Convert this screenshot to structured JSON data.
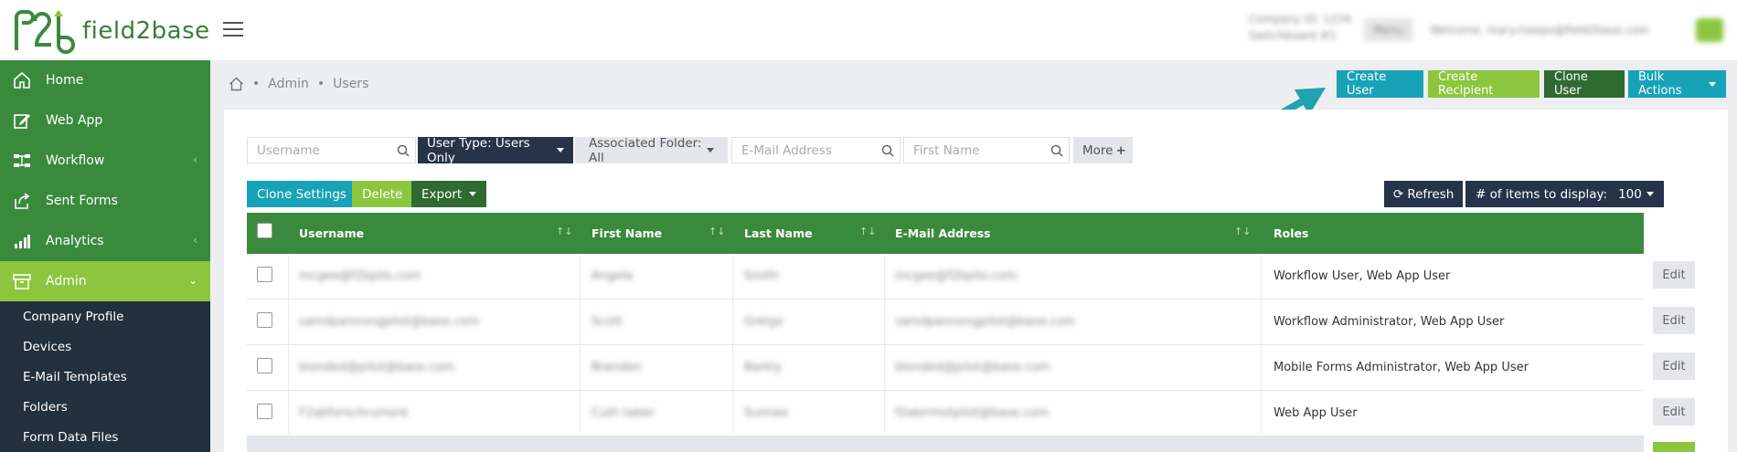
{
  "brand": {
    "name": "field2base",
    "colors": {
      "primary": "#3a8a3e",
      "accent": "#8cc63f",
      "dark": "#23303e",
      "teal": "#17a2b8"
    }
  },
  "account": {
    "company_line1": "Company ID: 1234",
    "company_line2": "Switchboard #1",
    "menu": "Menu",
    "welcome": "Welcome, mary.meeps@field2base.com"
  },
  "sidebar": {
    "items": [
      {
        "label": "Home",
        "icon": "home-icon"
      },
      {
        "label": "Web App",
        "icon": "edit-icon"
      },
      {
        "label": "Workflow",
        "icon": "workflow-icon"
      },
      {
        "label": "Sent Forms",
        "icon": "share-icon"
      },
      {
        "label": "Analytics",
        "icon": "bar-chart-icon"
      },
      {
        "label": "Admin",
        "icon": "archive-icon"
      }
    ],
    "submenu": [
      "Company Profile",
      "Devices",
      "E-Mail Templates",
      "Folders",
      "Form Data Files"
    ]
  },
  "breadcrumb": {
    "items": [
      "Admin",
      "Users"
    ]
  },
  "top_actions": {
    "create_user": "Create User",
    "create_recipient": "Create Recipient",
    "clone_user": "Clone User",
    "bulk_actions": "Bulk Actions"
  },
  "filters": {
    "username_placeholder": "Username",
    "user_type": "User Type: Users Only",
    "assoc_folder": "Associated Folder: All",
    "email_placeholder": "E-Mail Address",
    "firstname_placeholder": "First Name",
    "more": "More"
  },
  "actions": {
    "clone_settings": "Clone Settings",
    "delete": "Delete",
    "export": "Export",
    "refresh": "Refresh",
    "items_label": "# of items to display:",
    "items_value": "100"
  },
  "table": {
    "headers": [
      "Username",
      "First Name",
      "Last Name",
      "E-Mail Address",
      "Roles"
    ],
    "rows": [
      {
        "username": "mcgee@f2bpilo.com",
        "first": "Angela",
        "last": "Smith",
        "email": "mcgee@f2bpilo.com",
        "roles": "Workflow User, Web App User"
      },
      {
        "username": "samdpannongpilot@base.com",
        "first": "Scott",
        "last": "Greigo",
        "email": "samdpannongpilot@base.com",
        "roles": "Workflow Administrator, Web App User"
      },
      {
        "username": "blonded@pilot@base.com",
        "first": "Brenden",
        "last": "Barkly",
        "email": "blonded@pilot@base.com",
        "roles": "Mobile Forms Administrator, Web App User"
      },
      {
        "username": "F2abforschrumore",
        "first": "Cuth taber",
        "last": "Sunnex",
        "email": "f2abrrmstpilot@base.com",
        "roles": "Web App User"
      }
    ],
    "edit_label": "Edit"
  }
}
